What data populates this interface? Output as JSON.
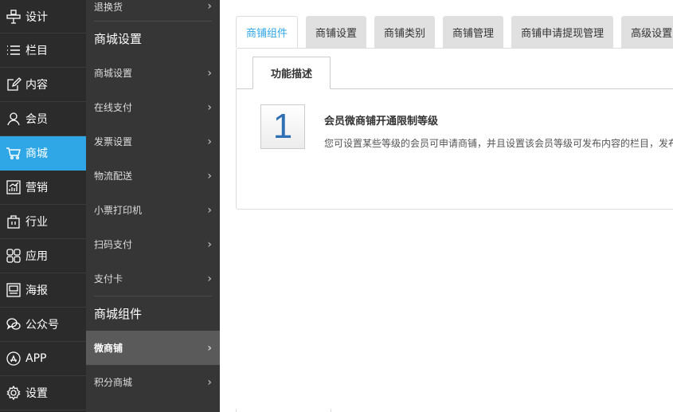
{
  "nav1": {
    "items": [
      {
        "label": "设计",
        "icon": "design-icon"
      },
      {
        "label": "栏目",
        "icon": "list-icon"
      },
      {
        "label": "内容",
        "icon": "edit-icon"
      },
      {
        "label": "会员",
        "icon": "user-icon"
      },
      {
        "label": "商城",
        "icon": "cart-icon"
      },
      {
        "label": "营销",
        "icon": "chart-icon"
      },
      {
        "label": "行业",
        "icon": "briefcase-icon"
      },
      {
        "label": "应用",
        "icon": "apps-icon"
      },
      {
        "label": "海报",
        "icon": "poster-icon"
      },
      {
        "label": "公众号",
        "icon": "wechat-icon"
      },
      {
        "label": "APP",
        "icon": "app-store-icon"
      },
      {
        "label": "设置",
        "icon": "gear-icon"
      }
    ],
    "active_color": "#2fa7e6"
  },
  "nav2": {
    "top_item": "退换货",
    "group1_title": "商城设置",
    "group1_items": [
      "商城设置",
      "在线支付",
      "发票设置",
      "物流配送",
      "小票打印机",
      "扫码支付",
      "支付卡"
    ],
    "group2_title": "商城组件",
    "group2_items": [
      "微商铺",
      "积分商城"
    ]
  },
  "tabs": [
    "商铺组件",
    "商铺设置",
    "商铺类别",
    "商铺管理",
    "商铺申请提现管理",
    "高级设置"
  ],
  "panel": {
    "subtab": "功能描述",
    "number": "1",
    "title": "会员微商铺开通限制等级",
    "desc": "您可设置某些等级的会员可申请商铺，并且设置该会员等级可发布内容的栏目，发布"
  }
}
